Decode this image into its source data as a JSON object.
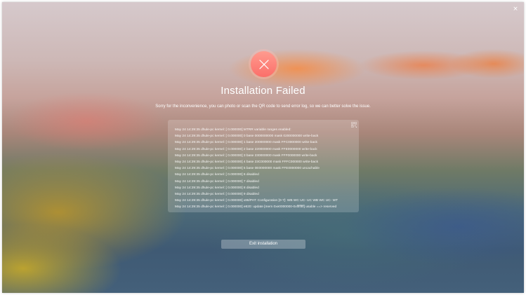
{
  "window": {
    "close_glyph": "×"
  },
  "status": {
    "icon": "error-x-icon",
    "accent_color": "#fb6f6a",
    "title": "Installation Failed",
    "message": "Sorry for the inconvenience, you can photo or scan the QR code to send error log, so we can better solve the issue."
  },
  "log": {
    "qr_icon": "qr-code-icon",
    "lines": [
      "May 24 14:29:35 dhule-pc kernel: [    0.000000] MTRR variable ranges enabled:",
      "May 24 14:29:35 dhule-pc kernel: [    0.000000]   0 base 0000000000 mask 0200000000 write-back",
      "May 24 14:29:35 dhule-pc kernel: [    0.000000]   1 base 200000000 mask FFC0000000 write-back",
      "May 24 14:29:35 dhule-pc kernel: [    0.000000]   2 base 220000000 mask FFE0000000 write-back",
      "May 24 14:29:35 dhule-pc kernel: [    0.000000]   3 base 230000000 mask FFF0000000 write-back",
      "May 24 14:29:35 dhule-pc kernel: [    0.000000]   4 base 23C000000 mask FFFC000000 write-back",
      "May 24 14:29:35 dhule-pc kernel: [    0.000000]   5 base 0E0000000 mask FFE0000000 uncachable",
      "May 24 14:29:35 dhule-pc kernel: [    0.000000]   6 disabled",
      "May 24 14:29:35 dhule-pc kernel: [    0.000000]   7 disabled",
      "May 24 14:29:35 dhule-pc kernel: [    0.000000]   8 disabled",
      "May 24 14:29:35 dhule-pc kernel: [    0.000000]   9 disabled",
      "May 24 14:29:35 dhule-pc kernel: [    0.000000] x86/PAT: Configuration [0-7]: WB  WC  UC- UC  WB  WC  UC- WT",
      "May 24 14:29:35 dhule-pc kernel: [    0.000000] e820: update [mem 0xe0000000-0xffffffff] usable ==> reserved"
    ]
  },
  "actions": {
    "exit_label": "Exit installation"
  }
}
